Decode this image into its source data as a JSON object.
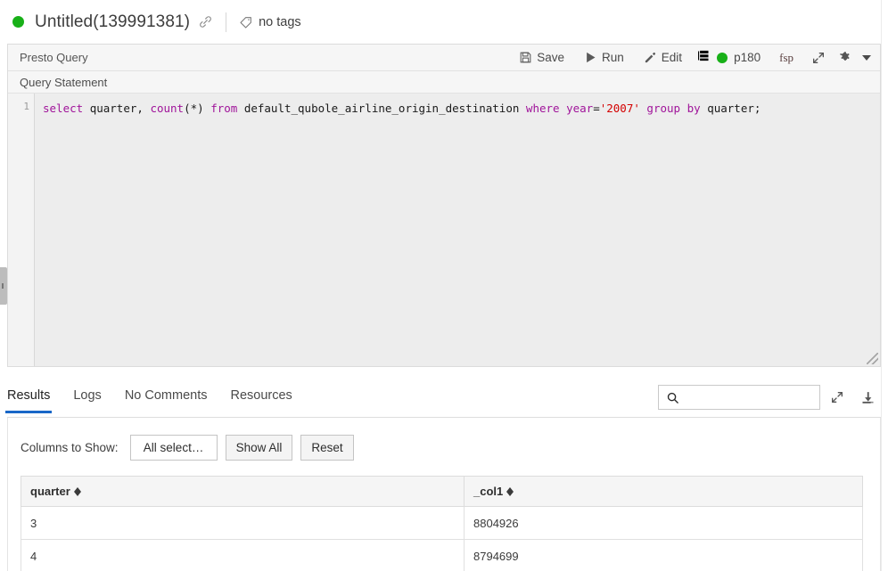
{
  "header": {
    "status_dot_color": "#18b018",
    "title": "Untitled(139991381)",
    "link_icon": "link-icon",
    "tag_icon": "tag-icon",
    "tags_text": "no tags"
  },
  "query_panel": {
    "engine_label": "Presto Query",
    "substrip_label": "Query Statement",
    "toolbar": {
      "save_label": "Save",
      "run_label": "Run",
      "edit_label": "Edit",
      "cluster_label": "p180",
      "cluster_dot_color": "#18b018",
      "fsp_label": "fsp",
      "expand_icon": "expand-arrows-icon",
      "settings_icon": "gear-icon",
      "caret_icon": "chevron-down-icon"
    },
    "editor": {
      "line_number": "1",
      "tokens": [
        {
          "t": "select",
          "c": "kw"
        },
        {
          "t": " ",
          "c": "punc"
        },
        {
          "t": "quarter",
          "c": "id"
        },
        {
          "t": ", ",
          "c": "punc"
        },
        {
          "t": "count",
          "c": "fn"
        },
        {
          "t": "(*) ",
          "c": "punc"
        },
        {
          "t": "from",
          "c": "kw"
        },
        {
          "t": " ",
          "c": "punc"
        },
        {
          "t": "default_qubole_airline_origin_destination",
          "c": "id"
        },
        {
          "t": " ",
          "c": "punc"
        },
        {
          "t": "where",
          "c": "kw"
        },
        {
          "t": " ",
          "c": "punc"
        },
        {
          "t": "year",
          "c": "kw"
        },
        {
          "t": "=",
          "c": "punc"
        },
        {
          "t": "'2007'",
          "c": "str"
        },
        {
          "t": " ",
          "c": "punc"
        },
        {
          "t": "group",
          "c": "kw"
        },
        {
          "t": " ",
          "c": "punc"
        },
        {
          "t": "by",
          "c": "kw"
        },
        {
          "t": " ",
          "c": "punc"
        },
        {
          "t": "quarter;",
          "c": "id"
        }
      ],
      "plain_text": "select quarter, count(*) from default_qubole_airline_origin_destination where year='2007' group by quarter;"
    }
  },
  "results": {
    "tabs": [
      {
        "label": "Results",
        "active": true
      },
      {
        "label": "Logs",
        "active": false
      },
      {
        "label": "No Comments",
        "active": false
      },
      {
        "label": "Resources",
        "active": false
      }
    ],
    "search": {
      "value": "",
      "placeholder": "",
      "icon": "search-icon"
    },
    "expand_icon": "expand-arrows-icon",
    "download_icon": "download-icon",
    "columns_control": {
      "label": "Columns to Show:",
      "select_value": "All select…",
      "show_all_label": "Show All",
      "reset_label": "Reset"
    },
    "table": {
      "columns": [
        "quarter",
        "_col1"
      ],
      "rows": [
        [
          "3",
          "8804926"
        ],
        [
          "4",
          "8794699"
        ]
      ]
    }
  }
}
